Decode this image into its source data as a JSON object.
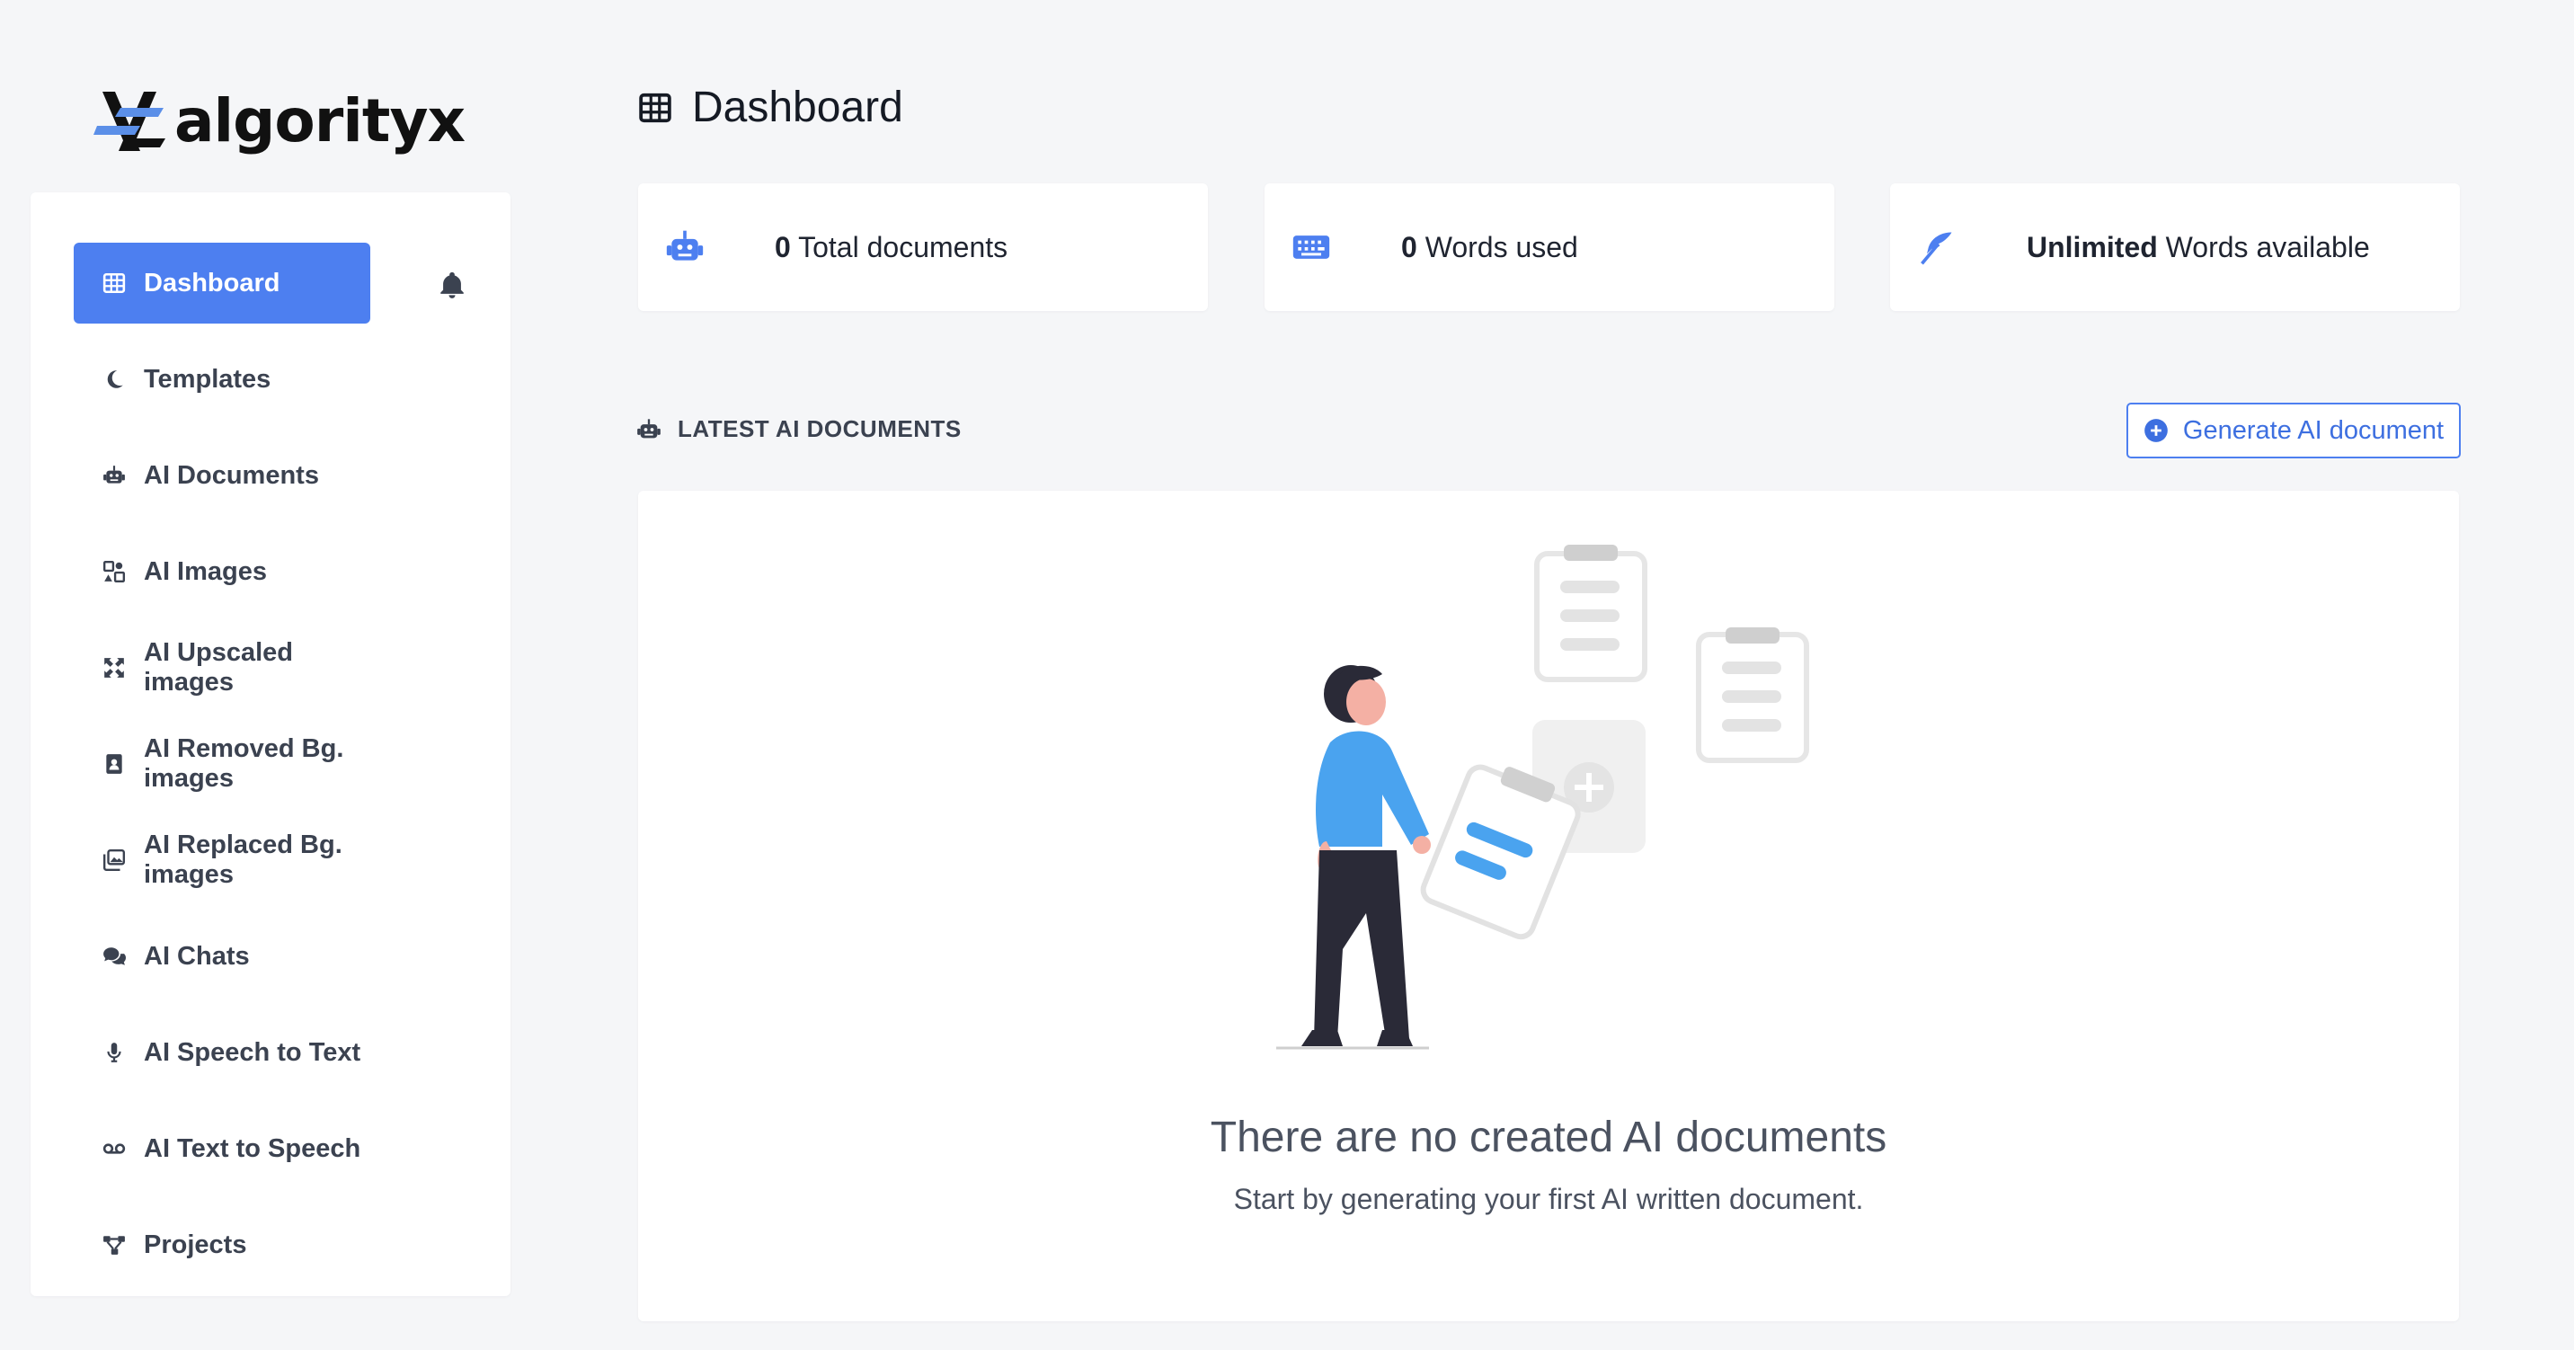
{
  "brand": {
    "name": "algorityx"
  },
  "colors": {
    "accent": "#4d7ff0",
    "background": "#f5f6f8",
    "card": "#ffffff",
    "text": "#1f2430"
  },
  "sidebar": {
    "items": [
      {
        "label": "Dashboard",
        "icon": "grid-icon",
        "active": true
      },
      {
        "label": "Templates",
        "icon": "moon-icon"
      },
      {
        "label": "AI Documents",
        "icon": "robot-icon"
      },
      {
        "label": "AI Images",
        "icon": "images-icon"
      },
      {
        "label": "AI Upscaled images",
        "icon": "expand-icon"
      },
      {
        "label": "AI Removed Bg. images",
        "icon": "portrait-icon"
      },
      {
        "label": "AI Replaced Bg. images",
        "icon": "photo-stack-icon"
      },
      {
        "label": "AI Chats",
        "icon": "chat-bubbles-icon"
      },
      {
        "label": "AI Speech to Text",
        "icon": "microphone-icon"
      },
      {
        "label": "AI Text to Speech",
        "icon": "voicemail-icon"
      },
      {
        "label": "Projects",
        "icon": "nodes-icon"
      }
    ],
    "notifications_icon": "bell-icon"
  },
  "header": {
    "title": "Dashboard",
    "icon": "grid-icon"
  },
  "stats": [
    {
      "value": "0",
      "label": "Total documents",
      "icon": "robot-icon"
    },
    {
      "value": "0",
      "label": "Words used",
      "icon": "keyboard-icon"
    },
    {
      "value": "Unlimited",
      "label": "Words available",
      "icon": "feather-icon"
    }
  ],
  "latest": {
    "title": "LATEST AI DOCUMENTS",
    "icon": "robot-icon",
    "generate_label": "Generate AI document",
    "generate_icon": "plus-circle-icon"
  },
  "empty_state": {
    "title": "There are no created AI documents",
    "subtitle": "Start by generating your first AI written document."
  }
}
